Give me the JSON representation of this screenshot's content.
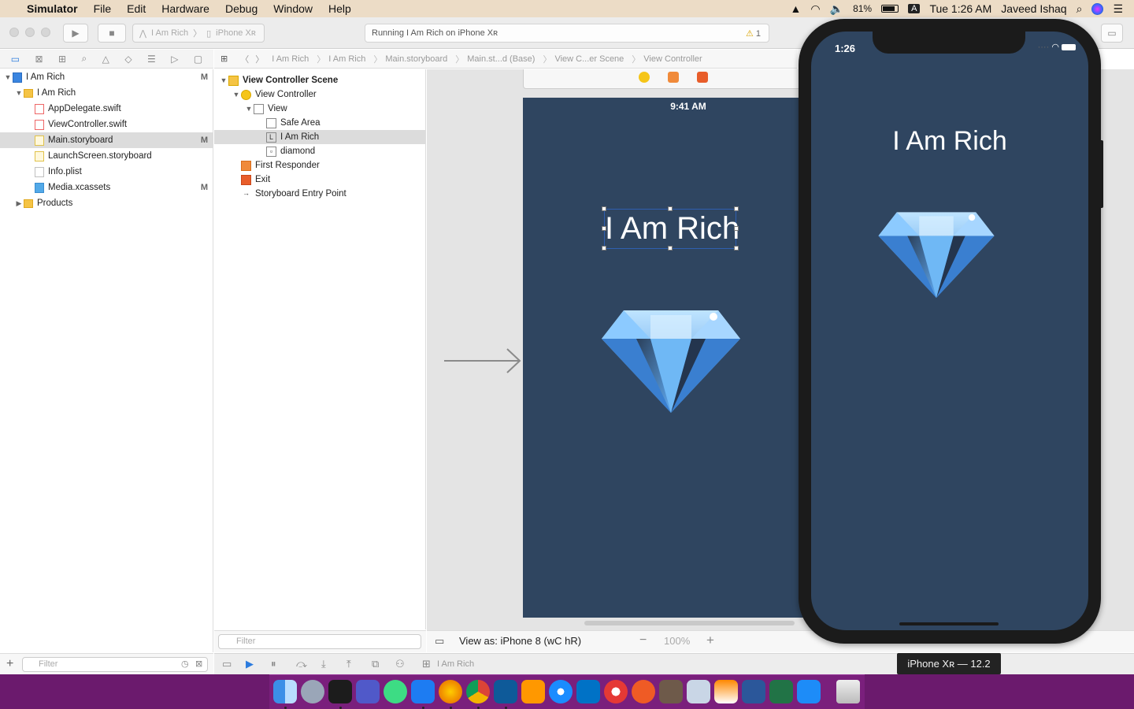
{
  "menubar": {
    "app_name": "Simulator",
    "items": [
      "File",
      "Edit",
      "Hardware",
      "Debug",
      "Window",
      "Help"
    ],
    "battery": "81%",
    "input_source": "A",
    "clock": "Tue 1:26 AM",
    "user": "Javeed Ishaq"
  },
  "toolbar": {
    "scheme": "I Am Rich",
    "device": "iPhone Xʀ",
    "activity_text": "Running I Am Rich on iPhone Xʀ",
    "warning_count": "1"
  },
  "navigator": {
    "items": [
      {
        "label": "I Am Rich",
        "type": "proj",
        "badge": "M",
        "level": 0,
        "disc": "▼"
      },
      {
        "label": "I Am Rich",
        "type": "folder",
        "badge": "",
        "level": 1,
        "disc": "▼"
      },
      {
        "label": "AppDelegate.swift",
        "type": "swift",
        "badge": "",
        "level": 2,
        "disc": ""
      },
      {
        "label": "ViewController.swift",
        "type": "swift",
        "badge": "",
        "level": 2,
        "disc": ""
      },
      {
        "label": "Main.storyboard",
        "type": "sb",
        "badge": "M",
        "level": 2,
        "disc": "",
        "selected": true
      },
      {
        "label": "LaunchScreen.storyboard",
        "type": "sb",
        "badge": "",
        "level": 2,
        "disc": ""
      },
      {
        "label": "Info.plist",
        "type": "plist",
        "badge": "",
        "level": 2,
        "disc": ""
      },
      {
        "label": "Media.xcassets",
        "type": "assets",
        "badge": "M",
        "level": 2,
        "disc": ""
      },
      {
        "label": "Products",
        "type": "folder",
        "badge": "",
        "level": 1,
        "disc": "▶"
      }
    ],
    "filter_placeholder": "Filter"
  },
  "jumpbar": {
    "crumbs": [
      "I Am Rich",
      "I Am Rich",
      "Main.storyboard",
      "Main.st...d (Base)",
      "View C...er Scene",
      "View Controller"
    ]
  },
  "outline": {
    "items": [
      {
        "label": "View Controller Scene",
        "icon": "scene",
        "level": 0,
        "disc": "▼",
        "bold": true
      },
      {
        "label": "View Controller",
        "icon": "vc",
        "level": 1,
        "disc": "▼"
      },
      {
        "label": "View",
        "icon": "view",
        "level": 2,
        "disc": "▼"
      },
      {
        "label": "Safe Area",
        "icon": "view",
        "level": 3,
        "disc": ""
      },
      {
        "label": "I Am Rich",
        "icon": "label",
        "level": 3,
        "disc": "",
        "selected": true
      },
      {
        "label": "diamond",
        "icon": "image",
        "level": 3,
        "disc": ""
      },
      {
        "label": "First Responder",
        "icon": "cube",
        "level": 1,
        "disc": ""
      },
      {
        "label": "Exit",
        "icon": "exit",
        "level": 1,
        "disc": ""
      },
      {
        "label": "Storyboard Entry Point",
        "icon": "arrow",
        "level": 1,
        "disc": ""
      }
    ],
    "filter_placeholder": "Filter"
  },
  "canvas": {
    "status_time": "9:41 AM",
    "label_text": "I Am Rich",
    "view_as": "View as: iPhone 8 (wC hR)",
    "zoom": "100%"
  },
  "debugbar": {
    "selected": "I Am Rich"
  },
  "simulator": {
    "time": "1:26",
    "label_text": "I Am Rich",
    "tooltip": "iPhone Xʀ — 12.2"
  },
  "colors": {
    "app_bg": "#2f4560",
    "menubar": "#ecdcc6",
    "dock": "#7a1f7c"
  }
}
